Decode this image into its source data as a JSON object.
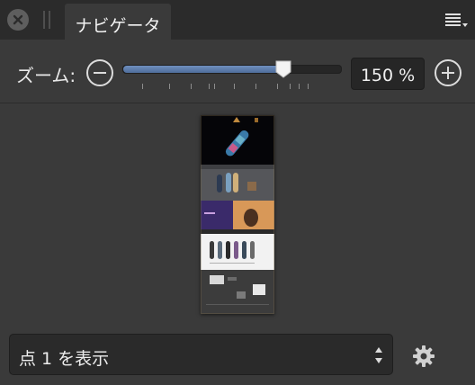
{
  "panel": {
    "tab_title": "ナビゲータ",
    "close_icon": "close-icon",
    "menu_icon": "panel-menu-icon"
  },
  "zoom": {
    "label": "ズーム:",
    "value_text": "150 %",
    "slider_fraction": 0.74,
    "zoom_out_icon": "zoom-out-icon",
    "zoom_in_icon": "zoom-in-icon"
  },
  "view_select": {
    "selected": "点 1 を表示",
    "settings_icon": "gear-icon"
  },
  "colors": {
    "accent": "#5a79a8",
    "panel_bg": "#3a3a3a",
    "tabbar_bg": "#2b2b2b"
  }
}
